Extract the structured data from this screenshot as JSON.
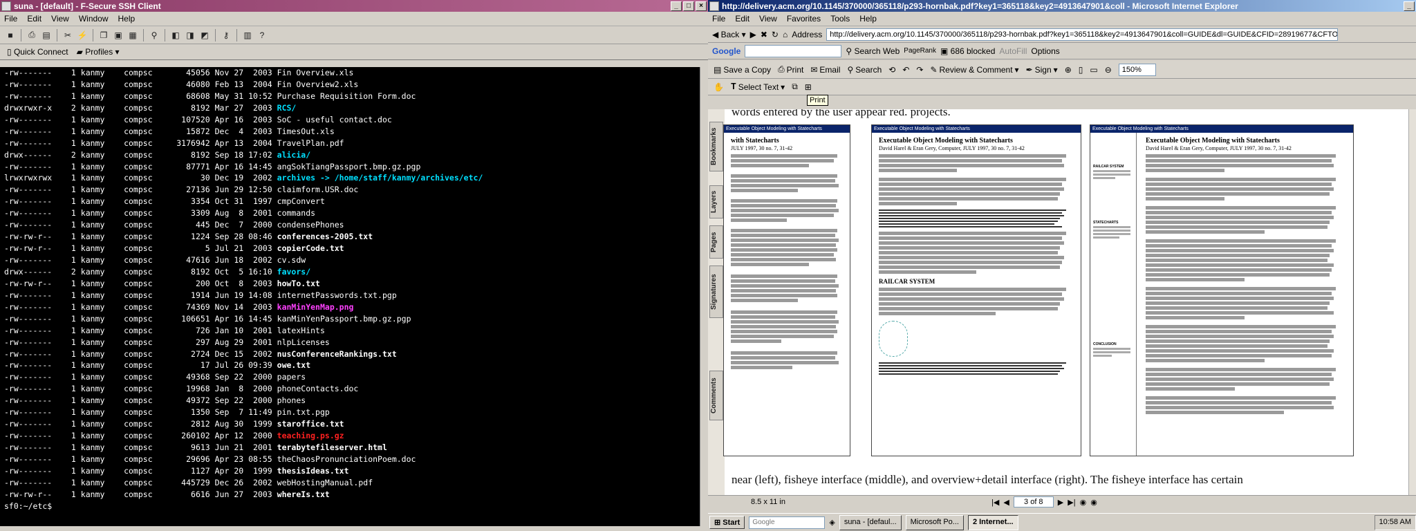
{
  "ssh": {
    "title": "suna - [default] - F-Secure SSH Client",
    "menu": [
      "File",
      "Edit",
      "View",
      "Window",
      "Help"
    ],
    "quick_connect": "Quick Connect",
    "profiles": "Profiles",
    "prompt": "sf0:~/etc$",
    "listing": [
      {
        "perm": "-rw-------",
        "n": "1",
        "user": "kanmy",
        "group": "compsc",
        "size": "45056",
        "date": "Nov 27  2003",
        "name": "Fin Overview.xls",
        "style": "norm"
      },
      {
        "perm": "-rw-------",
        "n": "1",
        "user": "kanmy",
        "group": "compsc",
        "size": "46080",
        "date": "Feb 13  2004",
        "name": "Fin Overview2.xls",
        "style": "norm"
      },
      {
        "perm": "-rw-------",
        "n": "1",
        "user": "kanmy",
        "group": "compsc",
        "size": "68608",
        "date": "May 31 10:52",
        "name": "Purchase Requisition Form.doc",
        "style": "norm"
      },
      {
        "perm": "drwxrwxr-x",
        "n": "2",
        "user": "kanmy",
        "group": "compsc",
        "size": "8192",
        "date": "Mar 27  2003",
        "name": "RCS/",
        "style": "dir"
      },
      {
        "perm": "-rw-------",
        "n": "1",
        "user": "kanmy",
        "group": "compsc",
        "size": "107520",
        "date": "Apr 16  2003",
        "name": "SoC - useful contact.doc",
        "style": "norm"
      },
      {
        "perm": "-rw-------",
        "n": "1",
        "user": "kanmy",
        "group": "compsc",
        "size": "15872",
        "date": "Dec  4  2003",
        "name": "TimesOut.xls",
        "style": "norm"
      },
      {
        "perm": "-rw-------",
        "n": "1",
        "user": "kanmy",
        "group": "compsc",
        "size": "3176942",
        "date": "Apr 13  2004",
        "name": "TravelPlan.pdf",
        "style": "norm"
      },
      {
        "perm": "drwx------",
        "n": "2",
        "user": "kanmy",
        "group": "compsc",
        "size": "8192",
        "date": "Sep 18 17:02",
        "name": "alicia/",
        "style": "dir"
      },
      {
        "perm": "-rw-------",
        "n": "1",
        "user": "kanmy",
        "group": "compsc",
        "size": "87771",
        "date": "Apr 16 14:45",
        "name": "angSokTiangPassport.bmp.gz.pgp",
        "style": "norm"
      },
      {
        "perm": "lrwxrwxrwx",
        "n": "1",
        "user": "kanmy",
        "group": "compsc",
        "size": "30",
        "date": "Dec 19  2002",
        "name": "archives -> /home/staff/kanmy/archives/etc/",
        "style": "link"
      },
      {
        "perm": "-rw-------",
        "n": "1",
        "user": "kanmy",
        "group": "compsc",
        "size": "27136",
        "date": "Jun 29 12:50",
        "name": "claimform.USR.doc",
        "style": "norm"
      },
      {
        "perm": "-rw-------",
        "n": "1",
        "user": "kanmy",
        "group": "compsc",
        "size": "3354",
        "date": "Oct 31  1997",
        "name": "cmpConvert",
        "style": "norm"
      },
      {
        "perm": "-rw-------",
        "n": "1",
        "user": "kanmy",
        "group": "compsc",
        "size": "3309",
        "date": "Aug  8  2001",
        "name": "commands",
        "style": "norm"
      },
      {
        "perm": "-rw-------",
        "n": "1",
        "user": "kanmy",
        "group": "compsc",
        "size": "445",
        "date": "Dec  7  2000",
        "name": "condensePhones",
        "style": "norm"
      },
      {
        "perm": "-rw-rw-r--",
        "n": "1",
        "user": "kanmy",
        "group": "compsc",
        "size": "1224",
        "date": "Sep 28 08:46",
        "name": "conferences-2005.txt",
        "style": "bold"
      },
      {
        "perm": "-rw-rw-r--",
        "n": "1",
        "user": "kanmy",
        "group": "compsc",
        "size": "5",
        "date": "Jul 21  2003",
        "name": "copierCode.txt",
        "style": "bold"
      },
      {
        "perm": "-rw-------",
        "n": "1",
        "user": "kanmy",
        "group": "compsc",
        "size": "47616",
        "date": "Jun 18  2002",
        "name": "cv.sdw",
        "style": "norm"
      },
      {
        "perm": "drwx------",
        "n": "2",
        "user": "kanmy",
        "group": "compsc",
        "size": "8192",
        "date": "Oct  5 16:10",
        "name": "favors/",
        "style": "dir"
      },
      {
        "perm": "-rw-rw-r--",
        "n": "1",
        "user": "kanmy",
        "group": "compsc",
        "size": "200",
        "date": "Oct  8  2003",
        "name": "howTo.txt",
        "style": "bold"
      },
      {
        "perm": "-rw-------",
        "n": "1",
        "user": "kanmy",
        "group": "compsc",
        "size": "1914",
        "date": "Jun 19 14:08",
        "name": "internetPasswords.txt.pgp",
        "style": "norm"
      },
      {
        "perm": "-rw-------",
        "n": "1",
        "user": "kanmy",
        "group": "compsc",
        "size": "74369",
        "date": "Nov 14  2003",
        "name": "kanMinYenMap.png",
        "style": "mag"
      },
      {
        "perm": "-rw-------",
        "n": "1",
        "user": "kanmy",
        "group": "compsc",
        "size": "106651",
        "date": "Apr 16 14:45",
        "name": "kanMinYenPassport.bmp.gz.pgp",
        "style": "norm"
      },
      {
        "perm": "-rw-------",
        "n": "1",
        "user": "kanmy",
        "group": "compsc",
        "size": "726",
        "date": "Jan 10  2001",
        "name": "latexHints",
        "style": "norm"
      },
      {
        "perm": "-rw-------",
        "n": "1",
        "user": "kanmy",
        "group": "compsc",
        "size": "297",
        "date": "Aug 29  2001",
        "name": "nlpLicenses",
        "style": "norm"
      },
      {
        "perm": "-rw-------",
        "n": "1",
        "user": "kanmy",
        "group": "compsc",
        "size": "2724",
        "date": "Dec 15  2002",
        "name": "nusConferenceRankings.txt",
        "style": "bold"
      },
      {
        "perm": "-rw-------",
        "n": "1",
        "user": "kanmy",
        "group": "compsc",
        "size": "17",
        "date": "Jul 26 09:39",
        "name": "owe.txt",
        "style": "bold"
      },
      {
        "perm": "-rw-------",
        "n": "1",
        "user": "kanmy",
        "group": "compsc",
        "size": "49368",
        "date": "Sep 22  2000",
        "name": "papers",
        "style": "norm"
      },
      {
        "perm": "-rw-------",
        "n": "1",
        "user": "kanmy",
        "group": "compsc",
        "size": "19968",
        "date": "Jan  8  2000",
        "name": "phoneContacts.doc",
        "style": "norm"
      },
      {
        "perm": "-rw-------",
        "n": "1",
        "user": "kanmy",
        "group": "compsc",
        "size": "49372",
        "date": "Sep 22  2000",
        "name": "phones",
        "style": "norm"
      },
      {
        "perm": "-rw-------",
        "n": "1",
        "user": "kanmy",
        "group": "compsc",
        "size": "1350",
        "date": "Sep  7 11:49",
        "name": "pin.txt.pgp",
        "style": "norm"
      },
      {
        "perm": "-rw-------",
        "n": "1",
        "user": "kanmy",
        "group": "compsc",
        "size": "2812",
        "date": "Aug 30  1999",
        "name": "staroffice.txt",
        "style": "bold"
      },
      {
        "perm": "-rw-------",
        "n": "1",
        "user": "kanmy",
        "group": "compsc",
        "size": "260102",
        "date": "Apr 12  2000",
        "name": "teaching.ps.gz",
        "style": "red"
      },
      {
        "perm": "-rw-------",
        "n": "1",
        "user": "kanmy",
        "group": "compsc",
        "size": "9613",
        "date": "Jun 21  2001",
        "name": "terabytefileserver.html",
        "style": "bold"
      },
      {
        "perm": "-rw-------",
        "n": "1",
        "user": "kanmy",
        "group": "compsc",
        "size": "29696",
        "date": "Apr 23 08:55",
        "name": "theChaosPronunciationPoem.doc",
        "style": "norm"
      },
      {
        "perm": "-rw-------",
        "n": "1",
        "user": "kanmy",
        "group": "compsc",
        "size": "1127",
        "date": "Apr 20  1999",
        "name": "thesisIdeas.txt",
        "style": "bold"
      },
      {
        "perm": "-rw-------",
        "n": "1",
        "user": "kanmy",
        "group": "compsc",
        "size": "445729",
        "date": "Dec 26  2002",
        "name": "webHostingManual.pdf",
        "style": "norm"
      },
      {
        "perm": "-rw-rw-r--",
        "n": "1",
        "user": "kanmy",
        "group": "compsc",
        "size": "6616",
        "date": "Jun 27  2003",
        "name": "whereIs.txt",
        "style": "bold"
      }
    ]
  },
  "ie": {
    "title": "http://delivery.acm.org/10.1145/370000/365118/p293-hornbak.pdf?key1=365118&key2=4913647901&coll - Microsoft Internet Explorer",
    "menu": [
      "File",
      "Edit",
      "View",
      "Favorites",
      "Tools",
      "Help"
    ],
    "back": "Back",
    "address_label": "Address",
    "address": "http://delivery.acm.org/10.1145/370000/365118/p293-hornbak.pdf?key1=365118&key2=4913647901&coll=GUIDE&dl=GUIDE&CFID=28919677&CFTO",
    "google": "Google",
    "search_web": "Search Web",
    "pagerank": "PageRank",
    "blocked": "686 blocked",
    "autofill": "AutoFill",
    "options": "Options"
  },
  "reader": {
    "save_copy": "Save a Copy",
    "print": "Print",
    "email": "Email",
    "search": "Search",
    "review": "Review & Comment",
    "sign": "Sign",
    "zoom": "150%",
    "select_text": "Select Text",
    "tooltip": "Print",
    "side_tabs": [
      "Bookmarks",
      "Layers",
      "Pages",
      "Signatures",
      "Comments"
    ],
    "top_text": "words entered by the user appear red.         projects.",
    "bottom_text": "near (left), fisheye interface (middle), and overview+detail interface (right). The fisheye interface has certain",
    "thumb_title": "Executable Object Modeling with Statecharts",
    "left_heading": "with Statecharts",
    "left_author": "JULY 1997, 30 no. 7, 31-42",
    "heading": "Executable Object Modeling with Statecharts",
    "author": "David Harel & Eran Gery, Computer, JULY 1997, 30 no. 7, 31-42",
    "railcar": "RAILCAR SYSTEM",
    "sidebar_labels": [
      "RAILCAR SYSTEM",
      "STATECHARTS",
      "CONCLUSION"
    ],
    "page_size": "8.5 x 11 in",
    "page_nav": "3 of 8"
  },
  "taskbar": {
    "start": "Start",
    "google": "Google",
    "tasks": [
      "suna - [defaul...",
      "Microsoft Po...",
      "2 Internet..."
    ],
    "clock": "10:58 AM"
  }
}
